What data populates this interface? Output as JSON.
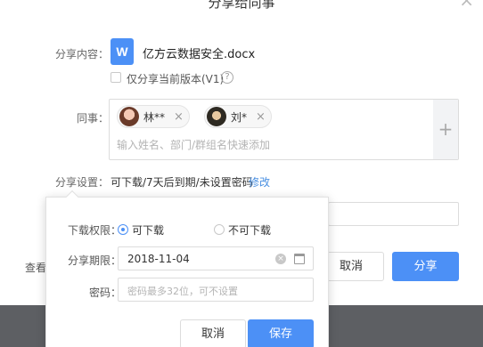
{
  "dialog": {
    "title": "分享给同事",
    "close_icon": "close-icon"
  },
  "content": {
    "label": "分享内容：",
    "file_icon_letter": "W",
    "file_name": "亿方云数据安全.docx",
    "version_checkbox_label": "仅分享当前版本(V1)",
    "version_checked": false,
    "help_icon": "?"
  },
  "colleagues": {
    "label": "同事：",
    "chips": [
      {
        "name": "林**",
        "remove": "×"
      },
      {
        "name": "刘*",
        "remove": "×"
      }
    ],
    "placeholder": "输入姓名、部门/群组名快速添加",
    "add_icon": "+"
  },
  "settings": {
    "label": "分享设置：",
    "value": "可下载/7天后到期/未设置密码",
    "modify_link": "修改"
  },
  "footer": {
    "view_link": "查看",
    "cancel_label": "取消",
    "share_label": "分享"
  },
  "popover": {
    "permission_label": "下载权限：",
    "options": [
      {
        "label": "可下载",
        "selected": true
      },
      {
        "label": "不可下载",
        "selected": false
      }
    ],
    "expiry_label": "分享期限：",
    "expiry_value": "2018-11-04",
    "password_label": "密码：",
    "password_placeholder": "密码最多32位，可不设置",
    "cancel_label": "取消",
    "save_label": "保存"
  },
  "colors": {
    "primary": "#4c90f6",
    "link": "#4a90e2",
    "overlay": "#5d5f63"
  }
}
